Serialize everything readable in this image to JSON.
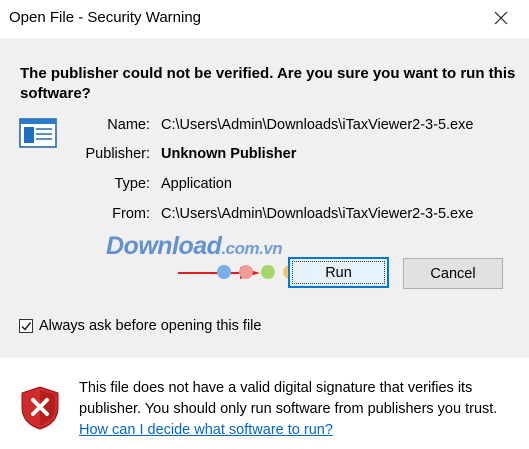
{
  "window": {
    "title": "Open File - Security Warning",
    "close_glyph": "✕"
  },
  "question": "The publisher could not be verified.  Are you sure you want to run this software?",
  "details": {
    "name_label": "Name:",
    "name_value": "C:\\Users\\Admin\\Downloads\\iTaxViewer2-3-5.exe",
    "publisher_label": "Publisher:",
    "publisher_value": "Unknown Publisher",
    "type_label": "Type:",
    "type_value": "Application",
    "from_label": "From:",
    "from_value": "C:\\Users\\Admin\\Downloads\\iTaxViewer2-3-5.exe"
  },
  "watermark": {
    "brand": "Download",
    "domain": ".com.vn",
    "dot_colors": [
      "#7aaee6",
      "#f29b9b",
      "#a5d66a",
      "#f6c46a",
      "#6aa0e0",
      "#e87b7b"
    ]
  },
  "buttons": {
    "run": "Run",
    "cancel": "Cancel"
  },
  "checkbox": {
    "label": "Always ask before opening this file",
    "checked": true
  },
  "warning": {
    "text": "This file does not have a valid digital signature that verifies its publisher.  You should only run software from publishers you trust.",
    "link": "How can I decide what software to run?"
  },
  "colors": {
    "accent": "#0078d7",
    "link": "#0066cc",
    "arrow": "#e02020"
  }
}
